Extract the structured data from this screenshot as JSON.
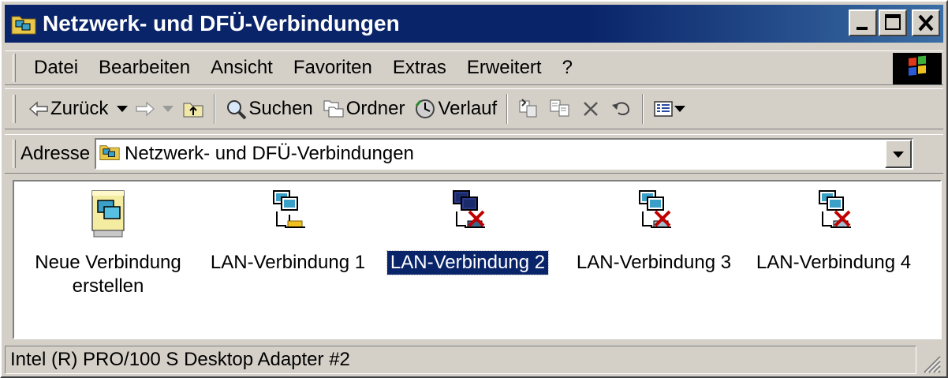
{
  "window": {
    "title": "Netzwerk- und DFÜ-Verbindungen",
    "title_bar_color": "#0a246a",
    "title_bar_gradient_end": "#3a6ea5"
  },
  "title_buttons": {
    "minimize_icon": "minimize-icon",
    "maximize_icon": "maximize-icon",
    "close_icon": "close-icon"
  },
  "menu": {
    "items": [
      "Datei",
      "Bearbeiten",
      "Ansicht",
      "Favoriten",
      "Extras",
      "Erweitert",
      "?"
    ]
  },
  "toolbar": {
    "back_label": "Zurück",
    "search_label": "Suchen",
    "folders_label": "Ordner",
    "history_label": "Verlauf"
  },
  "address": {
    "label": "Adresse",
    "value": "Netzwerk- und DFÜ-Verbindungen"
  },
  "items": [
    {
      "label": "Neue Verbindung erstellen",
      "icon": "new-connection-icon",
      "selected": false,
      "connected": true
    },
    {
      "label": "LAN-Verbindung 1",
      "icon": "lan-connection-icon",
      "selected": false,
      "connected": true
    },
    {
      "label": "LAN-Verbindung 2",
      "icon": "lan-disconnected-icon",
      "selected": true,
      "connected": false
    },
    {
      "label": "LAN-Verbindung 3",
      "icon": "lan-disconnected-icon",
      "selected": false,
      "connected": false
    },
    {
      "label": "LAN-Verbindung 4",
      "icon": "lan-disconnected-icon",
      "selected": false,
      "connected": false
    }
  ],
  "status": {
    "text": "Intel (R) PRO/100 S Desktop Adapter #2"
  },
  "colors": {
    "face": "#d4d0c8",
    "selection": "#0a246a",
    "disconnect_x": "#c00000"
  }
}
